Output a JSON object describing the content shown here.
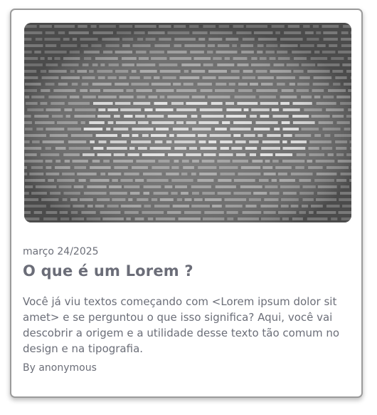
{
  "post": {
    "image_icon": "lorem-ipsum-text-image",
    "date": "março 24/2025",
    "title": "O que é um Lorem ?",
    "excerpt": "Você já viu textos começando com <Lorem ipsum dolor sit amet> e se perguntou o que isso significa? Aqui, você vai descobrir a origem e a utilidade desse texto tão comum no design e na tipografia.",
    "author": "By anonymous"
  }
}
